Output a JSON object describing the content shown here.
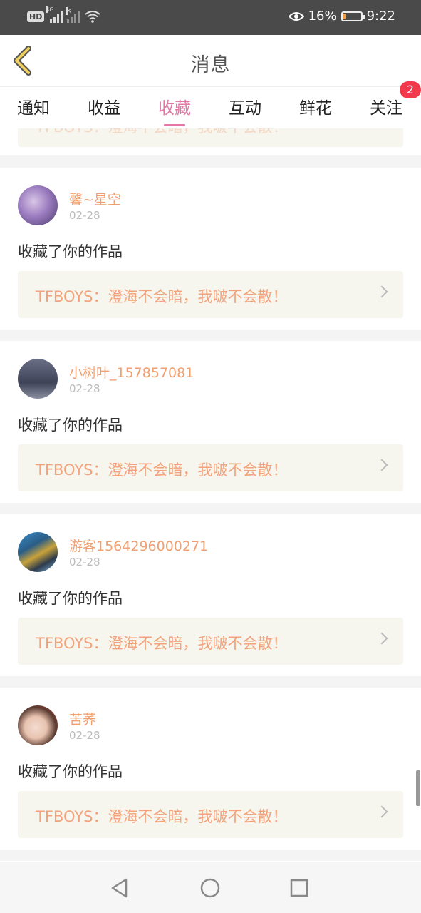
{
  "status_bar": {
    "hd_label": "HD",
    "network": "4G",
    "battery_percent": "16%",
    "battery_level": 0.16,
    "time": "9:22"
  },
  "header": {
    "title": "消息",
    "back_icon": "chevron-left-icon",
    "accent_color": "#f0d060"
  },
  "tabs": {
    "items": [
      {
        "label": "通知"
      },
      {
        "label": "收益"
      },
      {
        "label": "收藏"
      },
      {
        "label": "互动"
      },
      {
        "label": "鲜花"
      },
      {
        "label": "关注"
      }
    ],
    "active_index": 2,
    "active_color": "#e577a6",
    "badge_count": "2"
  },
  "feed": {
    "top_partial_title": "TFBOYS：澄海不会暗，我啵不会散！",
    "items": [
      {
        "username": "馨~星空",
        "date": "02-28",
        "action": "收藏了你的作品",
        "work_title": "TFBOYS：澄海不会暗，我啵不会散！"
      },
      {
        "username": "小树叶_157857081",
        "date": "02-28",
        "action": "收藏了你的作品",
        "work_title": "TFBOYS：澄海不会暗，我啵不会散！"
      },
      {
        "username": "游客1564296000271",
        "date": "02-28",
        "action": "收藏了你的作品",
        "work_title": "TFBOYS：澄海不会暗，我啵不会散！"
      },
      {
        "username": "苦荞",
        "date": "02-28",
        "action": "收藏了你的作品",
        "work_title": "TFBOYS：澄海不会暗，我啵不会散！"
      }
    ]
  },
  "nav_bar": {
    "back_icon": "triangle-back-icon",
    "home_icon": "circle-home-icon",
    "recents_icon": "square-recents-icon"
  }
}
